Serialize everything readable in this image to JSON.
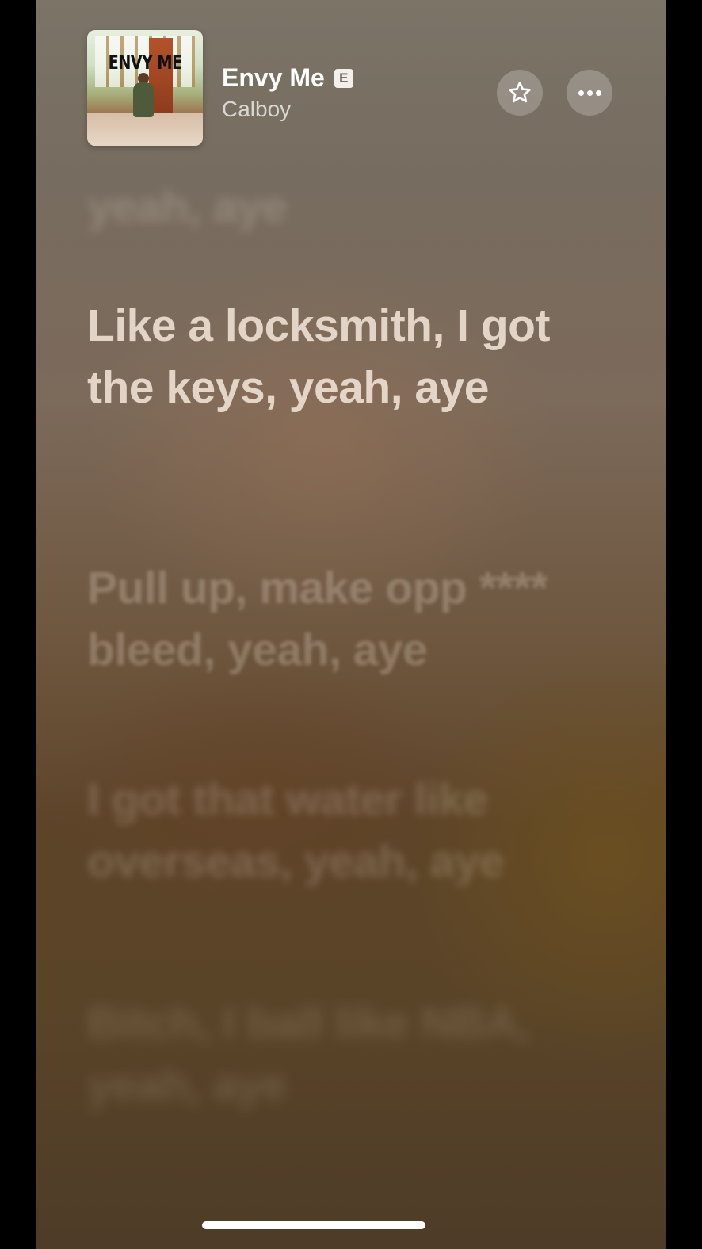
{
  "now_playing": {
    "title": "Envy Me",
    "explicit_badge": "E",
    "artist": "Calboy",
    "artwork": {
      "album_text": "ENVY ME"
    },
    "favorite_icon": "star-icon",
    "more_icon": "ellipsis-icon"
  },
  "lyrics": {
    "faded_top": "",
    "previous": "yeah, aye",
    "current": "Like a locksmith, I got the keys, yeah, aye",
    "next": "Pull up, make opp **** bleed, yeah, aye",
    "next2": "I got that water like overseas, yeah, aye",
    "next3": "Bitch, I ball like NBA, yeah, aye"
  },
  "colors": {
    "background_top": "#7b7467",
    "background_bottom": "#4e3c28",
    "current_lyric": "#f0e4d6"
  }
}
